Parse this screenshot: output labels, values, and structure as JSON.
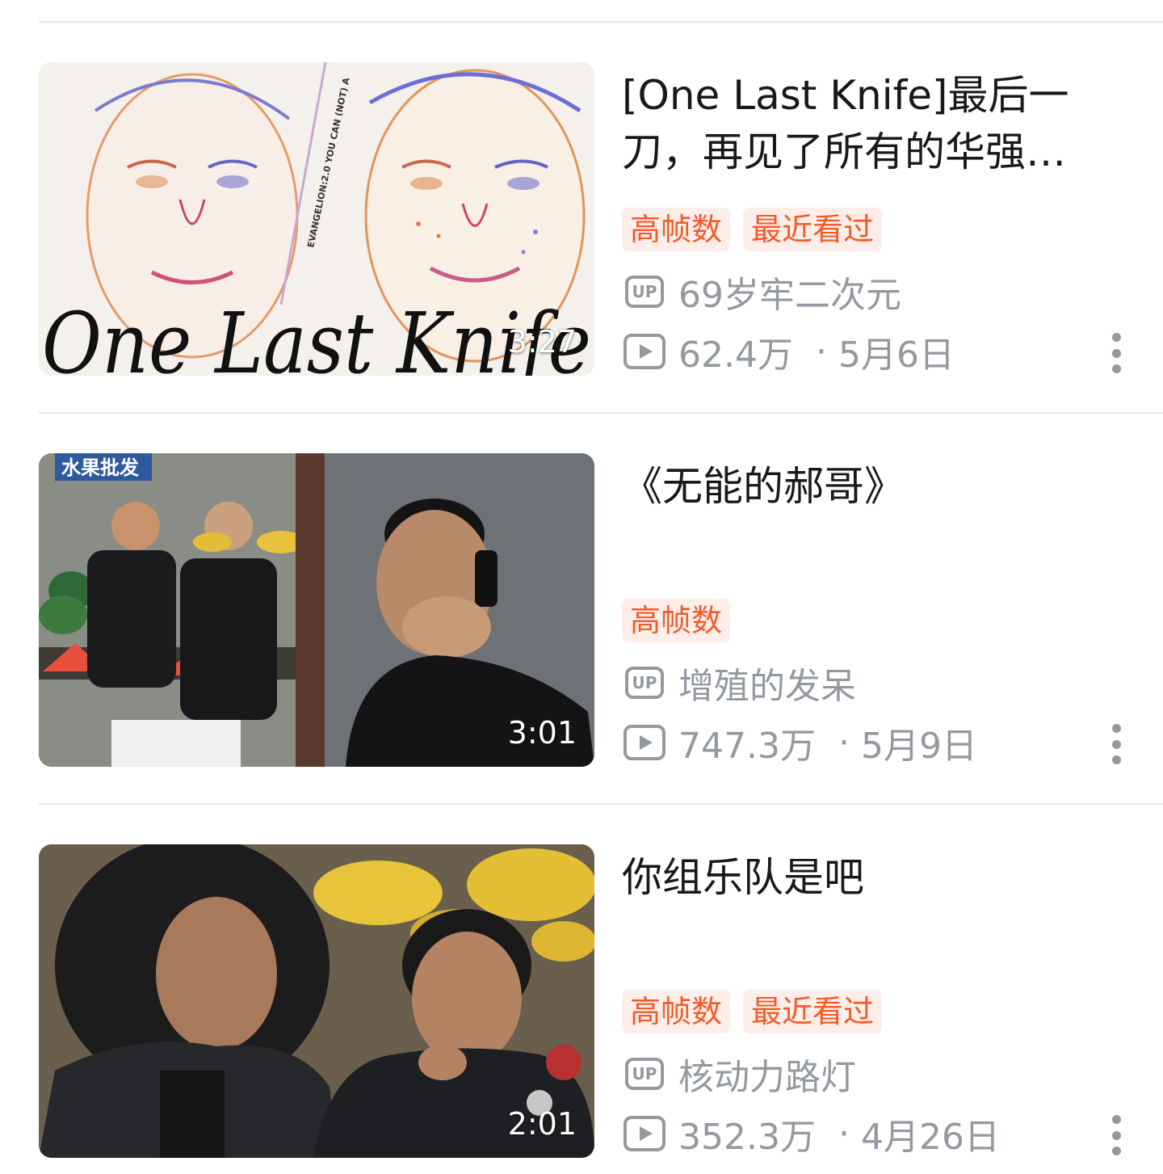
{
  "videos": [
    {
      "title": "[One Last Knife]最后一刀，再见了所有的华强…",
      "thumbnail_text": "One Last Knife",
      "thumbnail_side_text": "EVANGELION:2.0 YOU CAN (NOT) A",
      "duration": "3:27",
      "tags": [
        "高帧数",
        "最近看过"
      ],
      "up_icon": "UP",
      "uploader": "69岁牢二次元",
      "views": "62.4万",
      "separator": "·",
      "date": "5月6日"
    },
    {
      "title": "《无能的郝哥》",
      "thumbnail_sign": "水果批发",
      "duration": "3:01",
      "tags": [
        "高帧数"
      ],
      "up_icon": "UP",
      "uploader": "增殖的发呆",
      "views": "747.3万",
      "separator": "·",
      "date": "5月9日"
    },
    {
      "title": "你组乐队是吧",
      "duration": "2:01",
      "tags": [
        "高帧数",
        "最近看过"
      ],
      "up_icon": "UP",
      "uploader": "核动力路灯",
      "views": "352.3万",
      "separator": "·",
      "date": "4月26日"
    }
  ],
  "colors": {
    "tag_bg": "#fdeee9",
    "tag_text": "#f45a2a",
    "meta_text": "#9499a0",
    "title_text": "#18191c",
    "divider": "#e7e7e9"
  }
}
